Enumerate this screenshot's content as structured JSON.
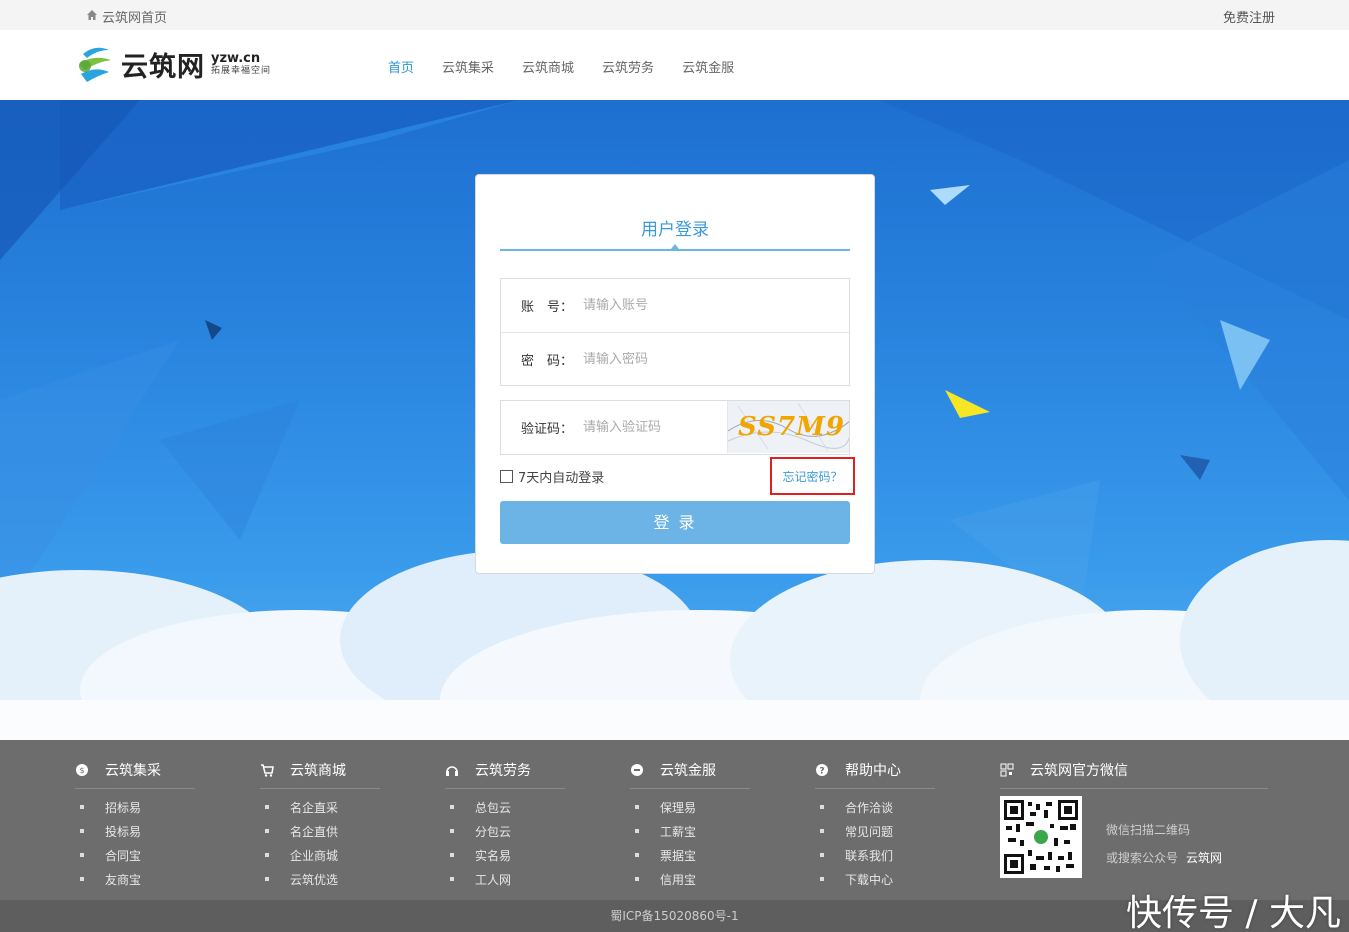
{
  "topbar": {
    "home_label": "云筑网首页",
    "register_label": "免费注册"
  },
  "header": {
    "logo_name": "云筑网",
    "logo_domain": "yzw.cn",
    "logo_slogan": "拓展幸福空间",
    "nav": [
      "首页",
      "云筑集采",
      "云筑商城",
      "云筑劳务",
      "云筑金服"
    ],
    "active_nav": "首页"
  },
  "login": {
    "title": "用户登录",
    "account_label": "账　号：",
    "account_placeholder": "请输入账号",
    "password_label": "密　码：",
    "password_placeholder": "请输入密码",
    "captcha_label": "验证码：",
    "captcha_placeholder": "请输入验证码",
    "captcha_text": "SS7M9",
    "remember_label": "7天内自动登录",
    "forgot_label": "忘记密码？",
    "submit_label": "登  录"
  },
  "footer": {
    "columns": [
      {
        "title": "云筑集采",
        "icon": "bag-icon",
        "items": [
          "招标易",
          "投标易",
          "合同宝",
          "友商宝"
        ]
      },
      {
        "title": "云筑商城",
        "icon": "cart-icon",
        "items": [
          "名企直采",
          "名企直供",
          "企业商城",
          "云筑优选"
        ]
      },
      {
        "title": "云筑劳务",
        "icon": "headset-icon",
        "items": [
          "总包云",
          "分包云",
          "实名易",
          "工人网"
        ]
      },
      {
        "title": "云筑金服",
        "icon": "coin-icon",
        "items": [
          "保理易",
          "工薪宝",
          "票据宝",
          "信用宝"
        ]
      },
      {
        "title": "帮助中心",
        "icon": "question-icon",
        "items": [
          "合作洽谈",
          "常见问题",
          "联系我们",
          "下载中心"
        ]
      }
    ],
    "wechat": {
      "title": "云筑网官方微信",
      "scan_text": "微信扫描二维码",
      "search_text": "或搜索公众号",
      "account_name": "云筑网"
    },
    "icp": "蜀ICP备15020860号-1"
  },
  "watermark": "快传号 / 大凡",
  "colors": {
    "accent": "#2a95d8",
    "button": "#6cb4e6",
    "footer": "#6d6d6d",
    "highlight_box": "#e02020"
  }
}
